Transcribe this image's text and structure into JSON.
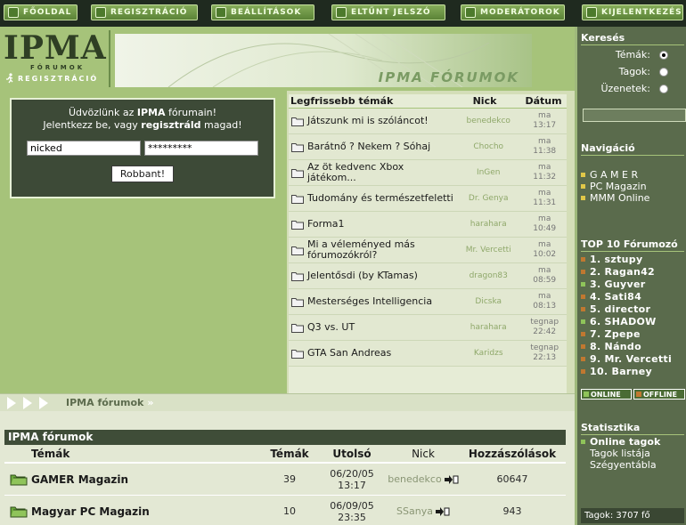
{
  "nav": [
    {
      "label": "FŐOLDAL",
      "icon": "arrow-icon"
    },
    {
      "label": "REGISZTRÁCIÓ",
      "icon": "runner-icon"
    },
    {
      "label": "BEÁLLÍTÁSOK",
      "icon": "settings-icon"
    },
    {
      "label": "ELTŰNT JELSZÓ",
      "icon": "key-icon"
    },
    {
      "label": "MODERÁTOROK",
      "icon": "moderators-icon"
    },
    {
      "label": "KIJELENTKEZÉS",
      "icon": "logout-icon"
    }
  ],
  "logo": {
    "big": "IPMA",
    "sub": "FÓRUMOK"
  },
  "register_link": "REGISZTRÁCIÓ",
  "banner_title": "IPMA FÓRUMOK",
  "welcome": {
    "line1_pre": "Üdvözlünk az ",
    "line1_bold": "IPMA",
    "line1_post": " fórumain!",
    "line2_pre": "Jelentkezz be, vagy ",
    "line2_bold": "regisztráld",
    "line2_post": " magad!",
    "username_value": "nicked",
    "password_value": "*********",
    "button": "Robbant!"
  },
  "latest": {
    "header_topic": "Legfrissebb témák",
    "header_nick": "Nick",
    "header_date": "Dátum",
    "rows": [
      {
        "topic": "Játszunk mi is szóláncot!",
        "nick": "benedekco",
        "day": "ma",
        "time": "13:17"
      },
      {
        "topic": "Barátnő ? Nekem ? Sóhaj",
        "nick": "Chocho",
        "day": "ma",
        "time": "11:38"
      },
      {
        "topic": "Az öt kedvenc Xbox játékom...",
        "nick": "InGen",
        "day": "ma",
        "time": "11:32"
      },
      {
        "topic": "Tudomány és természetfeletti",
        "nick": "Dr. Genya",
        "day": "ma",
        "time": "11:31"
      },
      {
        "topic": "Forma1",
        "nick": "harahara",
        "day": "ma",
        "time": "10:49"
      },
      {
        "topic": "Mi a véleményed más fórumozókról?",
        "nick": "Mr. Vercetti",
        "day": "ma",
        "time": "10:02"
      },
      {
        "topic": "Jelentősdi (by KTamas)",
        "nick": "dragon83",
        "day": "ma",
        "time": "08:59"
      },
      {
        "topic": "Mesterséges Intelligencia",
        "nick": "Dicska",
        "day": "ma",
        "time": "08:13"
      },
      {
        "topic": "Q3 vs. UT",
        "nick": "harahara",
        "day": "tegnap",
        "time": "22:42"
      },
      {
        "topic": "GTA San Andreas",
        "nick": "Karidzs",
        "day": "tegnap",
        "time": "22:13"
      }
    ]
  },
  "breadcrumb": {
    "label": "IPMA fórumok",
    "sep": "»"
  },
  "forums": {
    "title": "IPMA fórumok",
    "headers": {
      "topics": "Témák",
      "count": "Témák",
      "last": "Utolsó",
      "nick": "Nick",
      "posts": "Hozzászólások"
    },
    "rows": [
      {
        "name": "GAMER Magazin",
        "count": "39",
        "date": "06/20/05",
        "time": "13:17",
        "nick": "benedekco",
        "posts": "60647"
      },
      {
        "name": "Magyar PC Magazin",
        "count": "10",
        "date": "06/09/05",
        "time": "23:35",
        "nick": "SSanya",
        "posts": "943"
      }
    ]
  },
  "sidebar": {
    "search_title": "Keresés",
    "search_opts": [
      "Témák:",
      "Tagok:",
      "Üzenetek:"
    ],
    "nav_title": "Navigáció",
    "nav_items": [
      "G A M E R",
      "PC Magazin",
      "MMM Online"
    ],
    "top_title": "TOP 10 Fórumozó",
    "top_items": [
      "1. sztupy",
      "2. Ragan42",
      "3. Guyver",
      "4. Sati84",
      "5. director",
      "6. SHADOW",
      "7. Zpepe",
      "8. Nándo",
      "9. Mr. Vercetti",
      "10. Barney"
    ],
    "online_label": "ONLINE",
    "offline_label": "OFFLINE",
    "stats_title": "Statisztika",
    "stats_items": [
      "Online tagok",
      "Tagok listája",
      "Szégyentábla"
    ],
    "members_footer": "Tagok: 3707 fő"
  },
  "colors": {
    "accent_green": "#a6c37a",
    "dark_panel": "#3d4a37",
    "online": "#8fc45a",
    "offline": "#c07830"
  }
}
